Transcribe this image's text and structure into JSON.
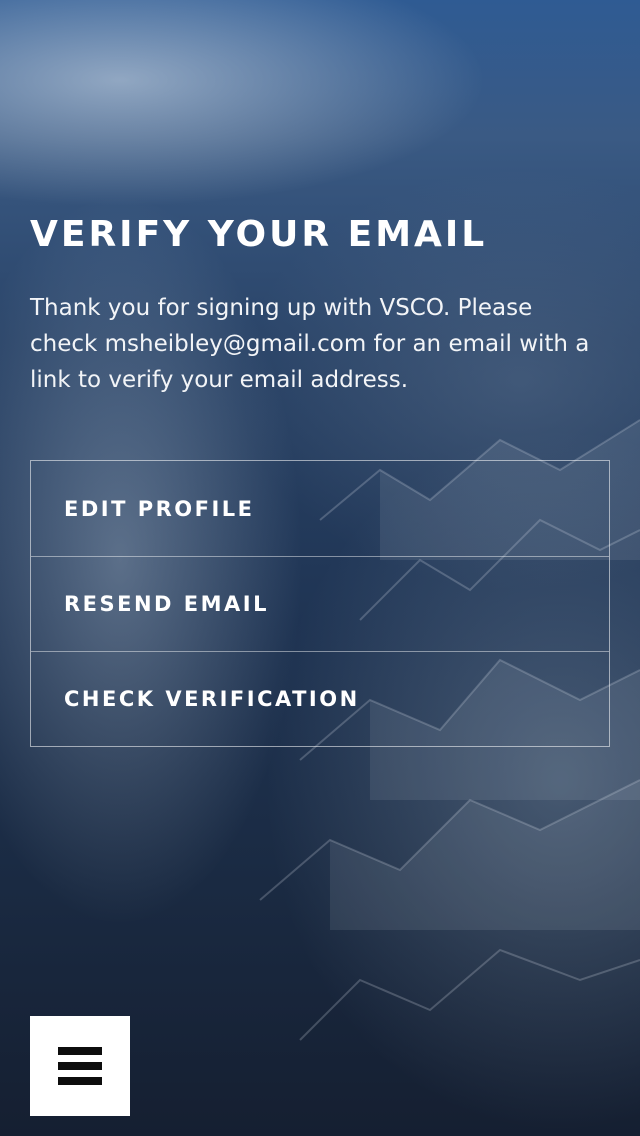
{
  "verify": {
    "title": "VERIFY YOUR EMAIL",
    "message": "Thank you for signing up with VSCO. Please check msheibley@gmail.com for an email with a link to verify your email address."
  },
  "actions": [
    {
      "label": "EDIT PROFILE"
    },
    {
      "label": "RESEND EMAIL"
    },
    {
      "label": "CHECK VERIFICATION"
    }
  ],
  "menu": {
    "icon": "hamburger-menu-icon"
  },
  "colors": {
    "text": "#ffffff",
    "menu_button_bg": "#ffffff",
    "menu_icon": "#0d0d0d",
    "border": "rgba(255,255,255,0.55)"
  }
}
